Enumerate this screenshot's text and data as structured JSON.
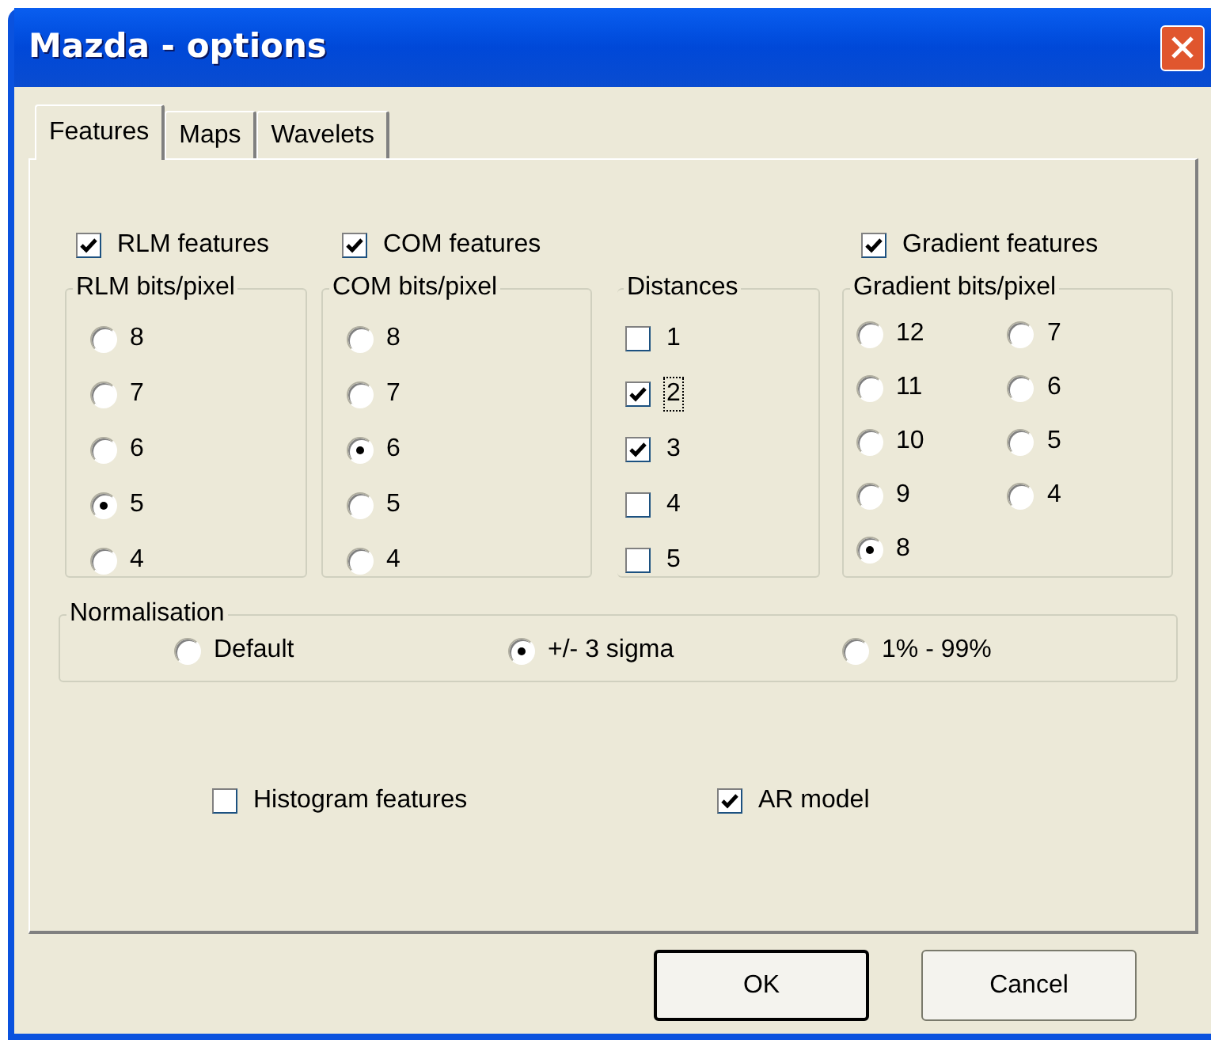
{
  "window": {
    "title": "Mazda - options"
  },
  "tabs": [
    {
      "label": "Features",
      "selected": true
    },
    {
      "label": "Maps",
      "selected": false
    },
    {
      "label": "Wavelets",
      "selected": false
    }
  ],
  "feature_checks": [
    {
      "label": "RLM features",
      "checked": true
    },
    {
      "label": "COM features",
      "checked": true
    },
    {
      "label": "Gradient features",
      "checked": true
    }
  ],
  "rlm_bits": {
    "title": "RLM bits/pixel",
    "options": [
      {
        "label": "8",
        "selected": false
      },
      {
        "label": "7",
        "selected": false
      },
      {
        "label": "6",
        "selected": false
      },
      {
        "label": "5",
        "selected": true
      },
      {
        "label": "4",
        "selected": false
      }
    ]
  },
  "com_bits": {
    "title": "COM bits/pixel",
    "options": [
      {
        "label": "8",
        "selected": false
      },
      {
        "label": "7",
        "selected": false
      },
      {
        "label": "6",
        "selected": true
      },
      {
        "label": "5",
        "selected": false
      },
      {
        "label": "4",
        "selected": false
      }
    ]
  },
  "distances": {
    "title": "Distances",
    "items": [
      {
        "label": "1",
        "checked": false,
        "focused": false
      },
      {
        "label": "2",
        "checked": true,
        "focused": true
      },
      {
        "label": "3",
        "checked": true,
        "focused": false
      },
      {
        "label": "4",
        "checked": false,
        "focused": false
      },
      {
        "label": "5",
        "checked": false,
        "focused": false
      }
    ]
  },
  "gradient_bits": {
    "title": "Gradient bits/pixel",
    "options": [
      {
        "label": "12",
        "selected": false
      },
      {
        "label": "11",
        "selected": false
      },
      {
        "label": "10",
        "selected": false
      },
      {
        "label": "9",
        "selected": false
      },
      {
        "label": "8",
        "selected": true
      },
      {
        "label": "7",
        "selected": false
      },
      {
        "label": "6",
        "selected": false
      },
      {
        "label": "5",
        "selected": false
      },
      {
        "label": "4",
        "selected": false
      }
    ]
  },
  "normalisation": {
    "title": "Normalisation",
    "options": [
      {
        "label": "Default",
        "selected": false
      },
      {
        "label": "+/- 3 sigma",
        "selected": true
      },
      {
        "label": "1% - 99%",
        "selected": false
      }
    ]
  },
  "extra_checks": [
    {
      "label": "Histogram features",
      "checked": false
    },
    {
      "label": "AR model",
      "checked": true
    }
  ],
  "buttons": [
    {
      "label": "OK",
      "default": true
    },
    {
      "label": "Cancel",
      "default": false
    }
  ]
}
